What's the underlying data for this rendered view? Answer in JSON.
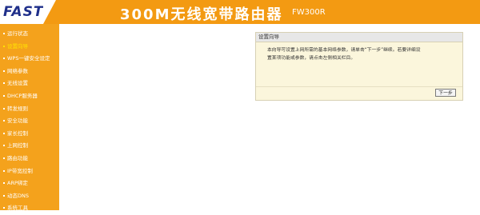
{
  "header": {
    "logo": "FAST",
    "title": "300M无线宽带路由器",
    "model": "FW300R"
  },
  "sidebar": {
    "items": [
      {
        "label": "运行状态",
        "active": false
      },
      {
        "label": "设置向导",
        "active": true
      },
      {
        "label": "WPS一键安全设定",
        "active": false
      },
      {
        "label": "网络参数",
        "active": false
      },
      {
        "label": "无线设置",
        "active": false
      },
      {
        "label": "DHCP服务器",
        "active": false
      },
      {
        "label": "转发规则",
        "active": false
      },
      {
        "label": "安全功能",
        "active": false
      },
      {
        "label": "家长控制",
        "active": false
      },
      {
        "label": "上网控制",
        "active": false
      },
      {
        "label": "路由功能",
        "active": false
      },
      {
        "label": "IP带宽控制",
        "active": false
      },
      {
        "label": "ARP绑定",
        "active": false
      },
      {
        "label": "动态DNS",
        "active": false
      },
      {
        "label": "系统工具",
        "active": false
      }
    ]
  },
  "panel": {
    "title": "设置向导",
    "line1": "本向导可设置上网所需的基本网络参数，请单击“下一步”继续。若要详细设",
    "line2": "置某项功能或参数，请点击左侧相关栏目。",
    "next_label": "下一步"
  }
}
